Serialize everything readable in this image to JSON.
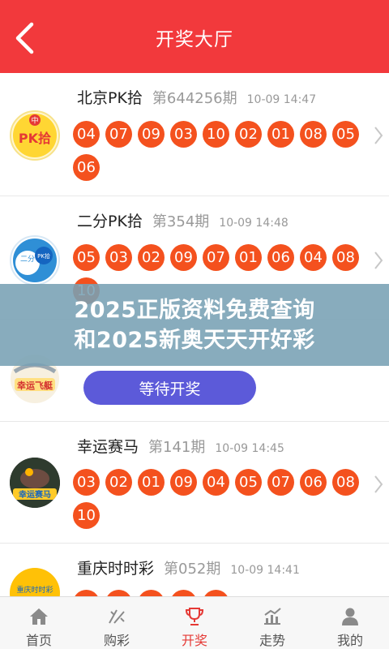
{
  "header": {
    "title": "开奖大厅",
    "back_icon": "chevron-left-icon"
  },
  "lotteries": [
    {
      "name": "北京PK拾",
      "issue": "第644256期",
      "time": "10-09 14:47",
      "logo_text": "PK拾",
      "logo_badge": "中",
      "numbers": [
        "04",
        "07",
        "09",
        "03",
        "10",
        "02",
        "01",
        "08",
        "05",
        "06"
      ]
    },
    {
      "name": "二分PK拾",
      "issue": "第354期",
      "time": "10-09 14:48",
      "logo_text_left": "二分",
      "logo_text_right": "PK拾",
      "numbers": [
        "05",
        "03",
        "02",
        "09",
        "07",
        "01",
        "06",
        "04",
        "08",
        "10"
      ]
    },
    {
      "logo_text": "幸运飞艇",
      "button_label": "等待开奖"
    },
    {
      "name": "幸运赛马",
      "issue": "第141期",
      "time": "10-09 14:45",
      "logo_text": "幸运赛马",
      "numbers": [
        "03",
        "02",
        "01",
        "09",
        "04",
        "05",
        "07",
        "06",
        "08",
        "10"
      ]
    },
    {
      "name": "重庆时时彩",
      "issue": "第052期",
      "time": "10-09 14:41",
      "logo_text": "重庆时时彩",
      "numbers": [
        "",
        "",
        "",
        "",
        ""
      ]
    }
  ],
  "banner": {
    "line1": "2025正版资料免费查询",
    "line2": "和2025新奥天天开好彩"
  },
  "tabs": [
    {
      "label": "首页",
      "icon": "home-icon"
    },
    {
      "label": "购彩",
      "icon": "lottery-icon"
    },
    {
      "label": "开奖",
      "icon": "trophy-icon",
      "active": true
    },
    {
      "label": "走势",
      "icon": "trend-chart-icon"
    },
    {
      "label": "我的",
      "icon": "user-icon"
    }
  ],
  "colors": {
    "header": "#f2393c",
    "ball": "#f4511e",
    "button": "#5c5ad9",
    "active_tab": "#e53935"
  }
}
